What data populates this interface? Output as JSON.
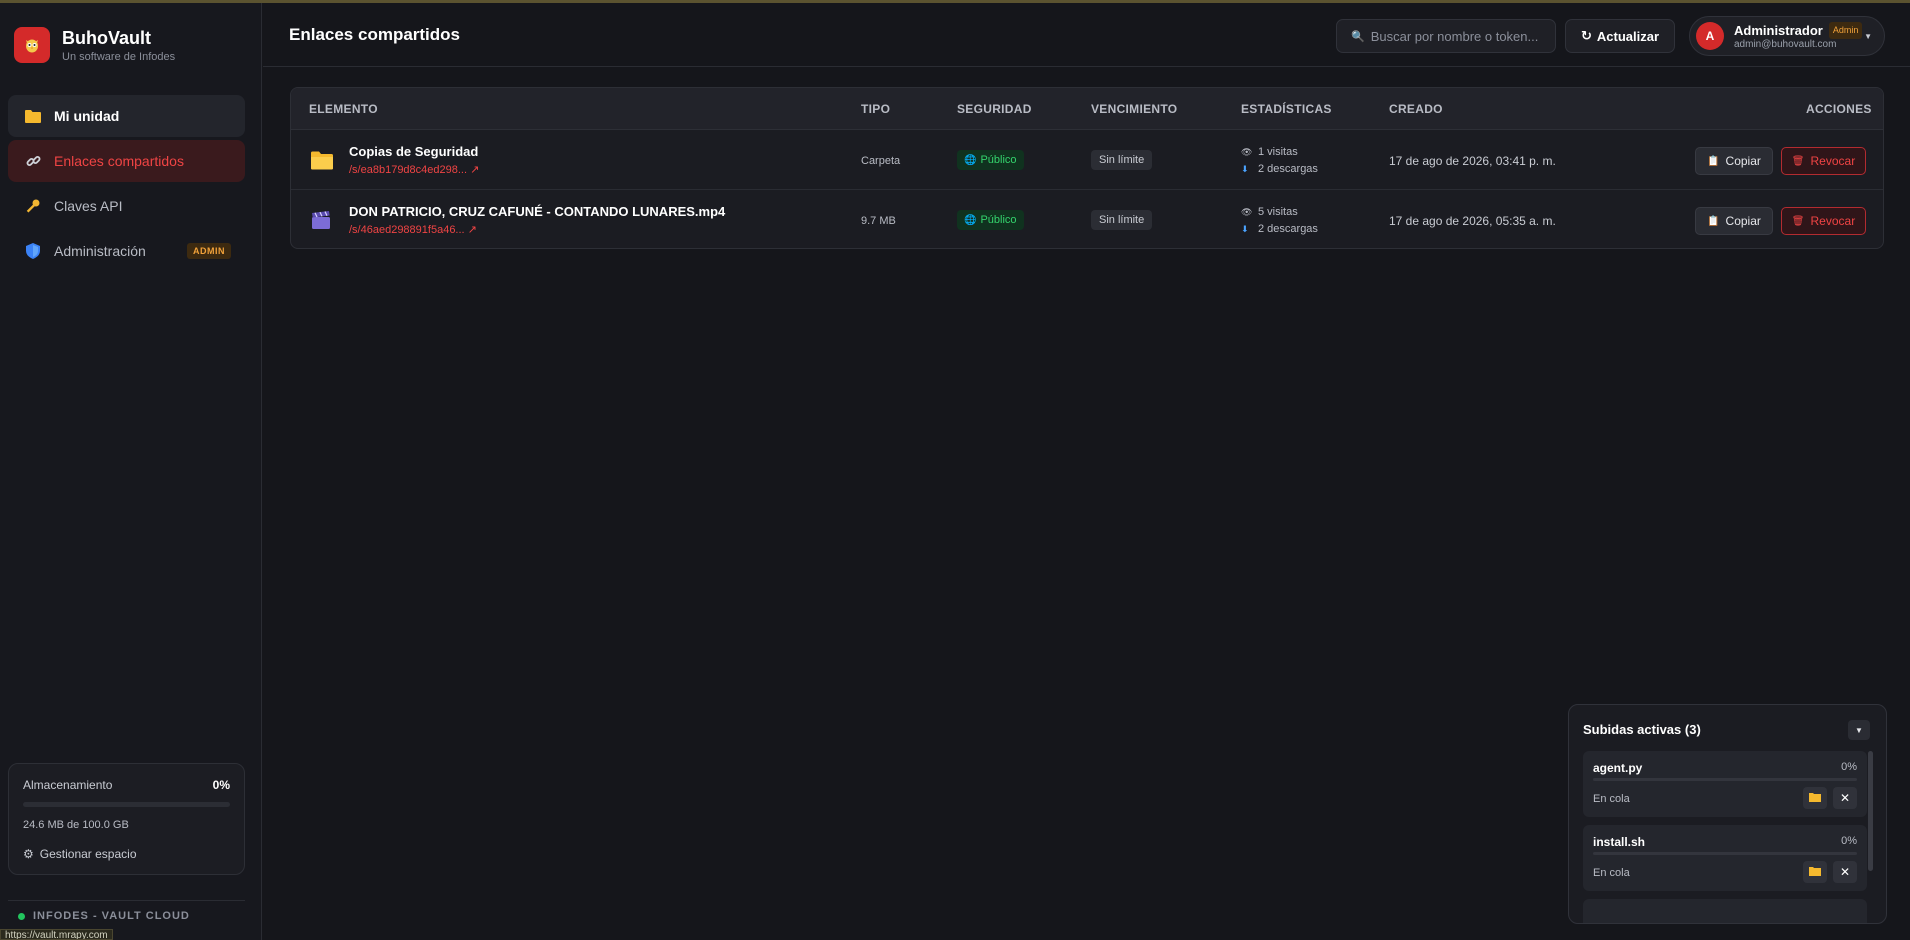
{
  "brand": {
    "name": "BuhoVault",
    "subtitle": "Un software de Infodes"
  },
  "sidebar": {
    "items": [
      {
        "label": "Mi unidad",
        "icon": "folder-icon"
      },
      {
        "label": "Enlaces compartidos",
        "icon": "link-icon"
      },
      {
        "label": "Claves API",
        "icon": "key-icon"
      },
      {
        "label": "Administración",
        "icon": "shield-icon",
        "badge": "ADMIN"
      }
    ],
    "storage": {
      "label": "Almacenamiento",
      "percent": "0%",
      "used_fraction": 0.0002,
      "used_text": "24.6 MB de 100.0 GB",
      "manage_label": "Gestionar espacio"
    },
    "footer_status": "INFODES - VAULT CLOUD",
    "url_tooltip": "https://vault.mrapy.com"
  },
  "header": {
    "title": "Enlaces compartidos",
    "search_placeholder": "Buscar por nombre o token...",
    "refresh_label": "Actualizar",
    "user": {
      "initial": "A",
      "name": "Administrador",
      "role": "Admin",
      "email": "admin@buhovault.com"
    }
  },
  "table": {
    "columns": [
      "ELEMENTO",
      "TIPO",
      "SEGURIDAD",
      "VENCIMIENTO",
      "ESTADÍSTICAS",
      "CREADO",
      "ACCIONES"
    ],
    "rows": [
      {
        "name": "Copias de Seguridad",
        "link": "/s/ea8b179d8c4ed298... ↗",
        "icon": "folder-icon",
        "type": "Carpeta",
        "security": "Público",
        "expiry": "Sin límite",
        "visits": "1 visitas",
        "downloads": "2 descargas",
        "created": "17 de ago de 2026, 03:41 p. m.",
        "copy_label": "Copiar",
        "revoke_label": "Revocar"
      },
      {
        "name": "DON PATRICIO, CRUZ CAFUNÉ - CONTANDO LUNARES.mp4",
        "link": "/s/46aed298891f5a46... ↗",
        "icon": "clapperboard-icon",
        "type": "9.7 MB",
        "security": "Público",
        "expiry": "Sin límite",
        "visits": "5 visitas",
        "downloads": "2 descargas",
        "created": "17 de ago de 2026, 05:35 a. m.",
        "copy_label": "Copiar",
        "revoke_label": "Revocar"
      }
    ]
  },
  "uploads": {
    "title": "Subidas activas (3)",
    "items": [
      {
        "name": "agent.py",
        "percent": "0%",
        "progress": 0,
        "status": "En cola"
      },
      {
        "name": "install.sh",
        "percent": "0%",
        "progress": 0,
        "status": "En cola"
      }
    ]
  },
  "colors": {
    "accent": "#d42a2a",
    "background": "#15161b",
    "public_green": "#34d36d",
    "admin_orange": "#f2a23a"
  }
}
